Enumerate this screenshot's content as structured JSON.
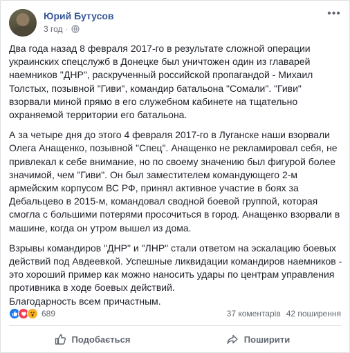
{
  "post": {
    "author": "Юрий Бутусов",
    "time": "3 год",
    "dot": "·",
    "paragraphs": [
      "Два года назад 8 февраля 2017-го в результате сложной операции украинских спецслужб в Донецке был уничтожен один из главарей наемников \"ДНР\", раскрученный российской пропагандой - Михаил Толстых, позывной \"Гиви\", командир батальона \"Сомали\". \"Гиви\" взорвали миной прямо в его служебном кабинете на тщательно охраняемой территории его батальона.",
      "А за четыре дня до этого 4 февраля 2017-го в Луганске наши взорвали Олега Анащенко, позывной \"Спец\". Анащенко не рекламировал себя, не привлекал к себе внимание, но по своему значению был фигурой более значимой, чем \"Гиви\". Он был заместителем командующего 2-м армейским корпусом ВС РФ, принял активное участие в боях за Дебальцево в 2015-м, командовал сводной боевой группой, которая смогла с большими потерями просочиться в город. Анащенко взорвали в машине, когда он утром вышел из дома.",
      "Взрывы командиров \"ДНР\" и \"ЛНР\" стали ответом на эскалацию боевых действий под Авдеевкой. Успешные ликвидации командиров наемников - это хороший пример как можно наносить удары по центрам управления противника в ходе боевых действий.\nБлагодарность всем причастным."
    ]
  },
  "stats": {
    "reactions_count": "689",
    "comments": "37 коментарів",
    "shares": "42 поширення"
  },
  "actions": {
    "like": "Подобається",
    "share": "Поширити"
  },
  "icons": {
    "options": "more-options-icon",
    "audience": "globe-icon",
    "like": "thumbs-up-icon",
    "share": "share-arrow-icon"
  },
  "colors": {
    "author": "#385898",
    "like_reaction": "#1877f2",
    "love_reaction": "#f33e58",
    "wow_reaction": "#f7b125"
  }
}
